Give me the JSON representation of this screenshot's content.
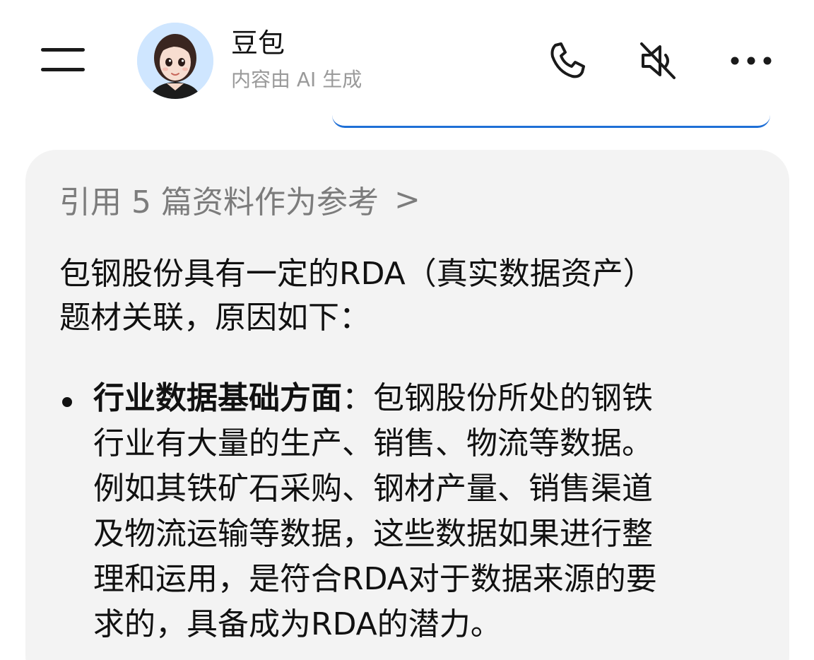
{
  "header": {
    "title": "豆包",
    "subtitle": "内容由 AI 生成",
    "menu_icon": "hamburger-icon",
    "call_icon": "phone-icon",
    "mute_icon": "speaker-muted-icon",
    "more_icon": "more-horizontal-icon"
  },
  "message": {
    "references_label": "引用 5 篇资料作为参考",
    "references_chevron": ">",
    "intro_lines": [
      "包钢股份具有一定的RDA（真实数据资产）",
      "题材关联，原因如下："
    ],
    "bullet": {
      "heading": "行业数据基础方面",
      "separator": "：",
      "first_line_rest": "包钢股份所处的钢铁",
      "lines": [
        "行业有大量的生产、销售、物流等数据。",
        "例如其铁矿石采购、钢材产量、销售渠道",
        "及物流运输等数据，这些数据如果进行整",
        "理和运用，是符合RDA对于数据来源的要",
        "求的，具备成为RDA的潜力。"
      ]
    }
  },
  "colors": {
    "accent_blue": "#1f6fd6",
    "card_background": "#f3f3f3",
    "muted_text": "#7c7c7c"
  }
}
